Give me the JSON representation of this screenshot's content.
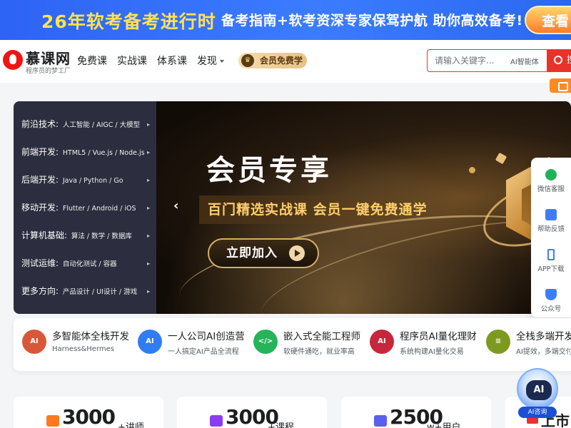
{
  "promo": {
    "title": "26年软考备考进行时",
    "subtitle": "备考指南+软考资深专家保驾护航  助你高效备考!",
    "button": "查看"
  },
  "header": {
    "logo": "慕课网",
    "logo_sub": "程序员的梦工厂",
    "nav": [
      "免费课",
      "实战课",
      "体系课",
      "发现"
    ],
    "vip_pill": "会员免费学",
    "search": {
      "placeholder": "请输入关键字...",
      "ai_tag": "AI智能体",
      "button": "搜"
    }
  },
  "menu": [
    {
      "category": "前沿技术:",
      "sub": "人工智能 / AIGC / 大模型"
    },
    {
      "category": "前端开发:",
      "sub": "HTML5 / Vue.js / Node.js"
    },
    {
      "category": "后端开发:",
      "sub": "Java / Python / Go"
    },
    {
      "category": "移动开发:",
      "sub": "Flutter / Android / iOS"
    },
    {
      "category": "计算机基础:",
      "sub": "算法 / 数学 / 数据库"
    },
    {
      "category": "测试运维:",
      "sub": "自动化测试 / 容器"
    },
    {
      "category": "更多方向:",
      "sub": "产品设计 / UI设计 / 游戏"
    }
  ],
  "banner": {
    "title": "会员专享",
    "subtitle": "百门精选实战课  会员一键免费通学",
    "cta": "立即加入"
  },
  "tools": [
    {
      "label": "微信客服",
      "icon": "wechat-icon"
    },
    {
      "label": "帮助反馈",
      "icon": "chat-icon"
    },
    {
      "label": "APP下载",
      "icon": "phone-icon"
    },
    {
      "label": "公众号",
      "icon": "shield-check-icon"
    }
  ],
  "courses": [
    {
      "title": "多智能体全栈开发",
      "sub": "Harness&Hermes",
      "icon_text": "AI",
      "color": "#d8573a"
    },
    {
      "title": "一人公司AI创造营",
      "sub": "一人搞定AI产品全流程",
      "icon_text": "AI",
      "color": "#2f7df0"
    },
    {
      "title": "嵌入式全能工程师",
      "sub": "软硬件通吃，就业率高",
      "icon_text": "</>",
      "color": "#27b35a"
    },
    {
      "title": "程序员AI量化理财",
      "sub": "系统构建AI量化交易",
      "icon_text": "AI",
      "color": "#c8263a"
    },
    {
      "title": "全栈多端开发",
      "sub": "AI提效，多端交付",
      "icon_text": "≡",
      "color": "#7d9a1f"
    }
  ],
  "stats": [
    {
      "num": "3000",
      "unit": "+讲师",
      "color": "#ff7a1f"
    },
    {
      "num": "3000",
      "unit": "+课程",
      "color": "#8a3df0"
    },
    {
      "num": "2500",
      "unit": "w+用户",
      "color": "#5b5ff0"
    }
  ],
  "stat4": {
    "text": "上市"
  },
  "ai_float": {
    "face": "AI",
    "label": "AI咨询"
  }
}
